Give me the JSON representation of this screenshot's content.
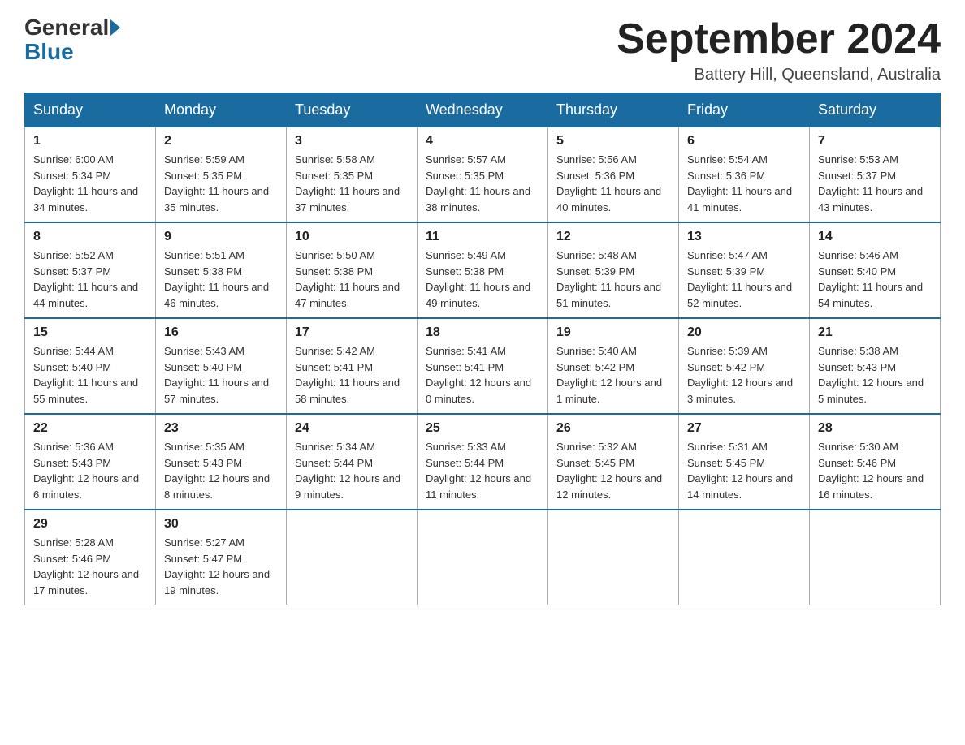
{
  "header": {
    "logo_general": "General",
    "logo_blue": "Blue",
    "month_title": "September 2024",
    "location": "Battery Hill, Queensland, Australia"
  },
  "days_of_week": [
    "Sunday",
    "Monday",
    "Tuesday",
    "Wednesday",
    "Thursday",
    "Friday",
    "Saturday"
  ],
  "weeks": [
    [
      {
        "day": "1",
        "sunrise": "6:00 AM",
        "sunset": "5:34 PM",
        "daylight": "11 hours and 34 minutes."
      },
      {
        "day": "2",
        "sunrise": "5:59 AM",
        "sunset": "5:35 PM",
        "daylight": "11 hours and 35 minutes."
      },
      {
        "day": "3",
        "sunrise": "5:58 AM",
        "sunset": "5:35 PM",
        "daylight": "11 hours and 37 minutes."
      },
      {
        "day": "4",
        "sunrise": "5:57 AM",
        "sunset": "5:35 PM",
        "daylight": "11 hours and 38 minutes."
      },
      {
        "day": "5",
        "sunrise": "5:56 AM",
        "sunset": "5:36 PM",
        "daylight": "11 hours and 40 minutes."
      },
      {
        "day": "6",
        "sunrise": "5:54 AM",
        "sunset": "5:36 PM",
        "daylight": "11 hours and 41 minutes."
      },
      {
        "day": "7",
        "sunrise": "5:53 AM",
        "sunset": "5:37 PM",
        "daylight": "11 hours and 43 minutes."
      }
    ],
    [
      {
        "day": "8",
        "sunrise": "5:52 AM",
        "sunset": "5:37 PM",
        "daylight": "11 hours and 44 minutes."
      },
      {
        "day": "9",
        "sunrise": "5:51 AM",
        "sunset": "5:38 PM",
        "daylight": "11 hours and 46 minutes."
      },
      {
        "day": "10",
        "sunrise": "5:50 AM",
        "sunset": "5:38 PM",
        "daylight": "11 hours and 47 minutes."
      },
      {
        "day": "11",
        "sunrise": "5:49 AM",
        "sunset": "5:38 PM",
        "daylight": "11 hours and 49 minutes."
      },
      {
        "day": "12",
        "sunrise": "5:48 AM",
        "sunset": "5:39 PM",
        "daylight": "11 hours and 51 minutes."
      },
      {
        "day": "13",
        "sunrise": "5:47 AM",
        "sunset": "5:39 PM",
        "daylight": "11 hours and 52 minutes."
      },
      {
        "day": "14",
        "sunrise": "5:46 AM",
        "sunset": "5:40 PM",
        "daylight": "11 hours and 54 minutes."
      }
    ],
    [
      {
        "day": "15",
        "sunrise": "5:44 AM",
        "sunset": "5:40 PM",
        "daylight": "11 hours and 55 minutes."
      },
      {
        "day": "16",
        "sunrise": "5:43 AM",
        "sunset": "5:40 PM",
        "daylight": "11 hours and 57 minutes."
      },
      {
        "day": "17",
        "sunrise": "5:42 AM",
        "sunset": "5:41 PM",
        "daylight": "11 hours and 58 minutes."
      },
      {
        "day": "18",
        "sunrise": "5:41 AM",
        "sunset": "5:41 PM",
        "daylight": "12 hours and 0 minutes."
      },
      {
        "day": "19",
        "sunrise": "5:40 AM",
        "sunset": "5:42 PM",
        "daylight": "12 hours and 1 minute."
      },
      {
        "day": "20",
        "sunrise": "5:39 AM",
        "sunset": "5:42 PM",
        "daylight": "12 hours and 3 minutes."
      },
      {
        "day": "21",
        "sunrise": "5:38 AM",
        "sunset": "5:43 PM",
        "daylight": "12 hours and 5 minutes."
      }
    ],
    [
      {
        "day": "22",
        "sunrise": "5:36 AM",
        "sunset": "5:43 PM",
        "daylight": "12 hours and 6 minutes."
      },
      {
        "day": "23",
        "sunrise": "5:35 AM",
        "sunset": "5:43 PM",
        "daylight": "12 hours and 8 minutes."
      },
      {
        "day": "24",
        "sunrise": "5:34 AM",
        "sunset": "5:44 PM",
        "daylight": "12 hours and 9 minutes."
      },
      {
        "day": "25",
        "sunrise": "5:33 AM",
        "sunset": "5:44 PM",
        "daylight": "12 hours and 11 minutes."
      },
      {
        "day": "26",
        "sunrise": "5:32 AM",
        "sunset": "5:45 PM",
        "daylight": "12 hours and 12 minutes."
      },
      {
        "day": "27",
        "sunrise": "5:31 AM",
        "sunset": "5:45 PM",
        "daylight": "12 hours and 14 minutes."
      },
      {
        "day": "28",
        "sunrise": "5:30 AM",
        "sunset": "5:46 PM",
        "daylight": "12 hours and 16 minutes."
      }
    ],
    [
      {
        "day": "29",
        "sunrise": "5:28 AM",
        "sunset": "5:46 PM",
        "daylight": "12 hours and 17 minutes."
      },
      {
        "day": "30",
        "sunrise": "5:27 AM",
        "sunset": "5:47 PM",
        "daylight": "12 hours and 19 minutes."
      },
      null,
      null,
      null,
      null,
      null
    ]
  ]
}
